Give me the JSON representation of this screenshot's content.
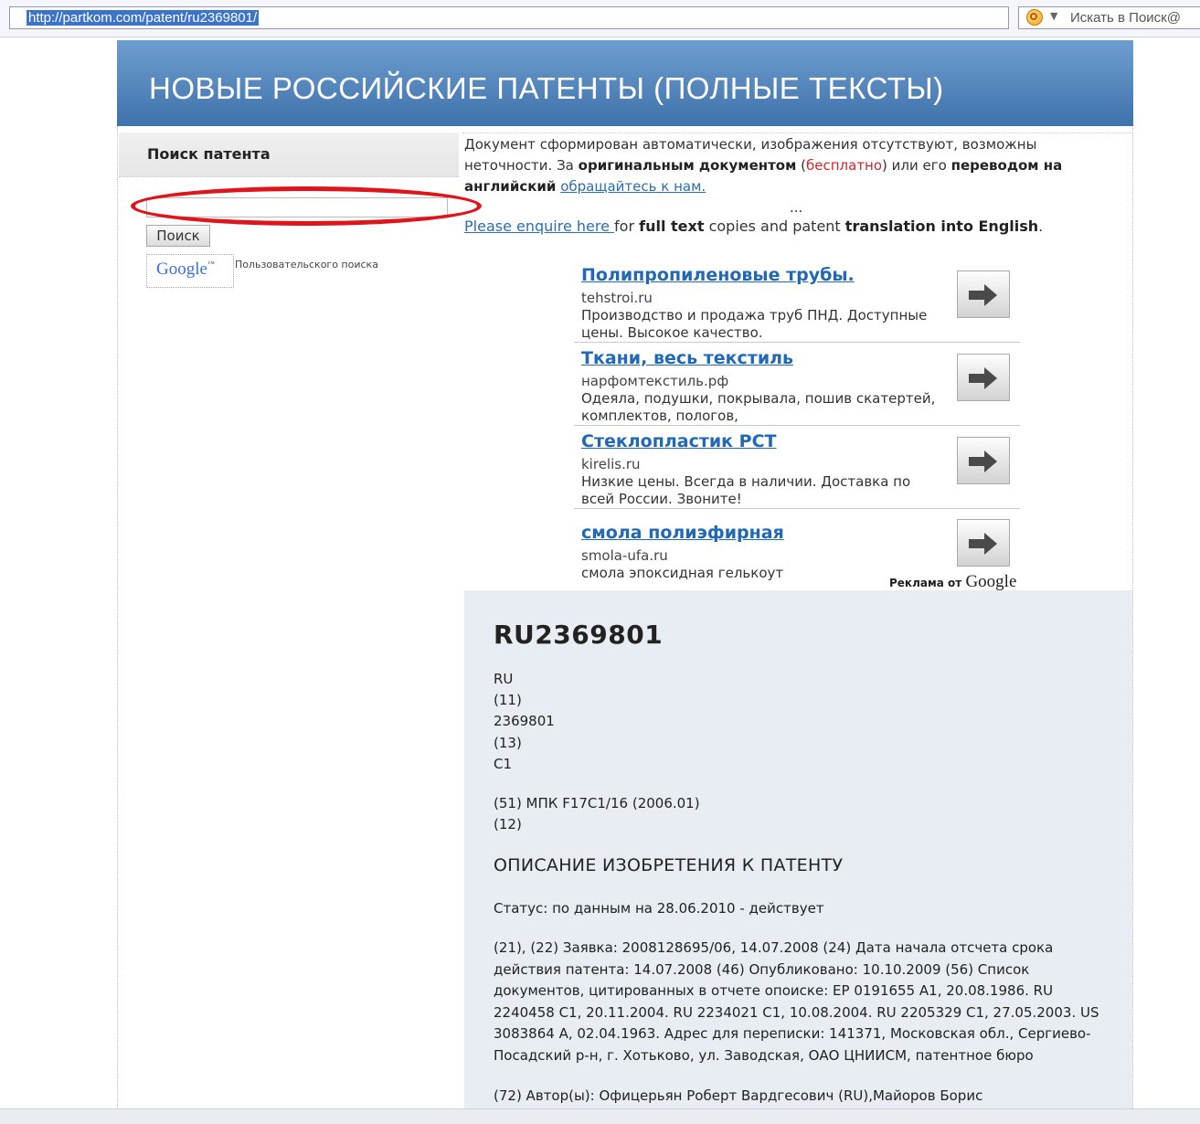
{
  "browser": {
    "url": "http://partkom.com/patent/ru2369801/",
    "search_placeholder": "Искать в Поиск@"
  },
  "header": {
    "title": "НОВЫЕ РОССИЙСКИЕ ПАТЕНТЫ (ПОЛНЫЕ ТЕКСТЫ)"
  },
  "sidebar": {
    "title": "Поиск патента",
    "search_value": "",
    "search_button": "Поиск",
    "google_logo": "Google",
    "google_tm": "™",
    "custom_search_label": "Пользовательского поиска"
  },
  "notice": {
    "part1": "Документ сформирован автоматически, изображения отсутствуют, возможны неточности. За ",
    "bold1": "оригинальным документом",
    "free_open": " (",
    "free": "бесплатно",
    "free_close": ") или его ",
    "bold2": "переводом на английский",
    "link": "обращайтесь к нам.",
    "ellipsis": "...",
    "english_link": "Please enquire here ",
    "english_mid1": "for ",
    "english_bold1": "full text",
    "english_mid2": " copies and patent ",
    "english_bold2": "translation into English",
    "english_end": "."
  },
  "ads": [
    {
      "title": "Полипропиленовые трубы.",
      "domain": "tehstroi.ru",
      "description": "Производство и продажа труб ПНД. Доступные цены. Высокое качество."
    },
    {
      "title": "Ткани, весь текстиль",
      "domain": "нарфомтекстиль.рф",
      "description": "Одеяла, подушки, покрывала, пошив скатертей, комплектов, пологов,"
    },
    {
      "title": "Стеклопластик РСТ",
      "domain": "kirelis.ru",
      "description": "Низкие цены. Всегда в наличии. Доставка по всей России. Звоните!"
    },
    {
      "title": "смола полиэфирная",
      "domain": "smola-ufa.ru",
      "description": "смола эпоксидная гелькоут"
    }
  ],
  "ads_attribution": {
    "prefix": "Реклама от ",
    "brand": "Google"
  },
  "patent": {
    "number": "RU2369801",
    "bib": [
      "RU",
      "(11)",
      "2369801",
      "(13)",
      "C1"
    ],
    "ipc": "(51)  МПК F17C1/16   (2006.01)",
    "code12": "(12)",
    "doc_title": "ОПИСАНИЕ ИЗОБРЕТЕНИЯ К ПАТЕНТУ",
    "status": "Статус: по данным на 28.06.2010 - действует",
    "application": "(21), (22) Заявка: 2008128695/06, 14.07.2008 (24) Дата начала отсчета срока действия патента: 14.07.2008 (46) Опубликовано: 10.10.2009 (56) Список документов, цитированных в отчете опоиске: EP 0191655 A1, 20.08.1986. RU 2240458 C1, 20.11.2004. RU 2234021 C1, 10.08.2004. RU 2205329 C1, 27.05.2003. US 3083864 A, 02.04.1963. Адрес для переписки: 141371, Московская обл., Сергиево-Посадский р-н, г. Хотьково, ул. Заводская, ОАО ЦНИИСМ, патентное бюро",
    "authors": "(72) Автор(ы): Офицерьян Роберт Вардгесович (RU),Майоров Борис"
  },
  "colors": {
    "header_gradient_top": "#6e9ed0",
    "header_gradient_bottom": "#3f72ab",
    "link": "#2a6eb3",
    "ad_title": "#2168b7",
    "highlight": "#e0151b",
    "panel_bg": "#e7edf2"
  }
}
